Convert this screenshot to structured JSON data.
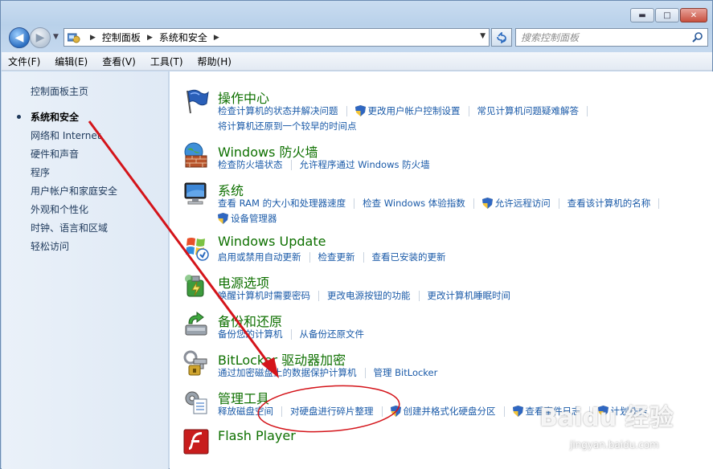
{
  "window": {
    "minimize_glyph": "▬",
    "maximize_glyph": "□",
    "close_glyph": "✕"
  },
  "navbar": {
    "back_glyph": "◀",
    "forward_glyph": "▶",
    "breadcrumb": [
      "控制面板",
      "系统和安全"
    ],
    "search_placeholder": "搜索控制面板"
  },
  "menu": [
    "文件(F)",
    "编辑(E)",
    "查看(V)",
    "工具(T)",
    "帮助(H)"
  ],
  "sidebar": {
    "home": "控制面板主页",
    "items": [
      "系统和安全",
      "网络和 Internet",
      "硬件和声音",
      "程序",
      "用户帐户和家庭安全",
      "外观和个性化",
      "时钟、语言和区域",
      "轻松访问"
    ],
    "current_index": 0
  },
  "categories": [
    {
      "title": "操作中心",
      "icon": "flag-icon",
      "links": [
        "检查计算机的状态并解决问题",
        "更改用户帐户控制设置",
        "常见计算机问题疑难解答"
      ],
      "links2": [
        "将计算机还原到一个较早的时间点"
      ]
    },
    {
      "title": "Windows 防火墙",
      "icon": "firewall-icon",
      "links": [
        "检查防火墙状态",
        "允许程序通过 Windows 防火墙"
      ]
    },
    {
      "title": "系统",
      "icon": "computer-icon",
      "links": [
        "查看 RAM 的大小和处理器速度",
        "检查 Windows 体验指数",
        "允许远程访问",
        "查看该计算机的名称"
      ],
      "links2": [
        "设备管理器"
      ]
    },
    {
      "title": "Windows Update",
      "icon": "windows-update-icon",
      "links": [
        "启用或禁用自动更新",
        "检查更新",
        "查看已安装的更新"
      ]
    },
    {
      "title": "电源选项",
      "icon": "power-icon",
      "links": [
        "唤醒计算机时需要密码",
        "更改电源按钮的功能",
        "更改计算机睡眠时间"
      ]
    },
    {
      "title": "备份和还原",
      "icon": "backup-icon",
      "links": [
        "备份您的计算机",
        "从备份还原文件"
      ]
    },
    {
      "title": "BitLocker 驱动器加密",
      "icon": "bitlocker-icon",
      "links": [
        "通过加密磁盘上的数据保护计算机",
        "管理 BitLocker"
      ]
    },
    {
      "title": "管理工具",
      "icon": "admin-tools-icon",
      "links": [
        "释放磁盘空间",
        "对硬盘进行碎片整理",
        "创建并格式化硬盘分区",
        "查看事件日志",
        "计划任务"
      ]
    },
    {
      "title": "Flash Player",
      "icon": "flash-icon",
      "links": []
    }
  ],
  "watermark": {
    "logo": "Baidu 经验",
    "url": "jingyan.baidu.com"
  },
  "colors": {
    "annotation_red": "#d4141a",
    "category_title": "#0e7000",
    "link": "#1a5aa8"
  }
}
